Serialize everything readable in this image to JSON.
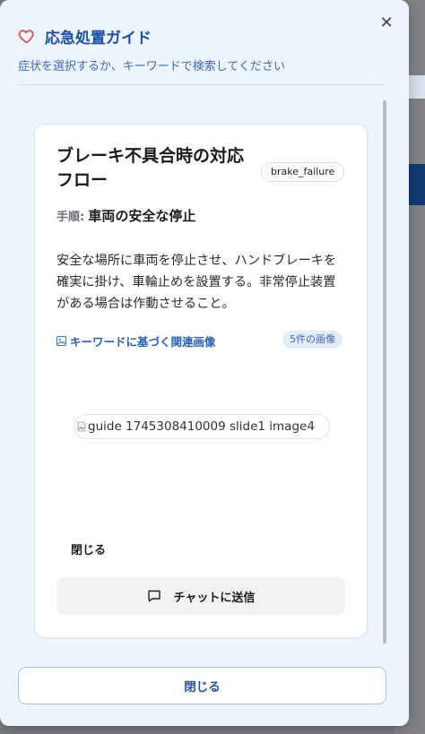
{
  "header": {
    "title": "応急処置ガイド",
    "subtitle": "症状を選択するか、キーワードで検索してください",
    "close_glyph": "✕"
  },
  "card": {
    "title": "ブレーキ不具合時の対応フロー",
    "tag": "brake_failure",
    "step_label": "手順:",
    "step_value": "車両の安全な停止",
    "description": "安全な場所に車両を停止させ、ハンドブレーキを確実に掛け、車輪止めを設置する。非常停止装置がある場合は作動させること。",
    "related_label": "キーワードに基づく関連画像",
    "image_count": "5件の画像",
    "image_alt": "guide 1745308410009 slide1 image4",
    "close_label": "閉じる",
    "send_label": "チャットに送信"
  },
  "footer": {
    "close_label": "閉じる"
  },
  "colors": {
    "accent": "#1e4ea8",
    "heart": "#e0404a",
    "modal_bg": "#eef5ff"
  },
  "icons": {
    "header": "heart-icon",
    "related": "image-icon",
    "send": "chat-bubble-icon",
    "broken": "broken-image-icon"
  }
}
